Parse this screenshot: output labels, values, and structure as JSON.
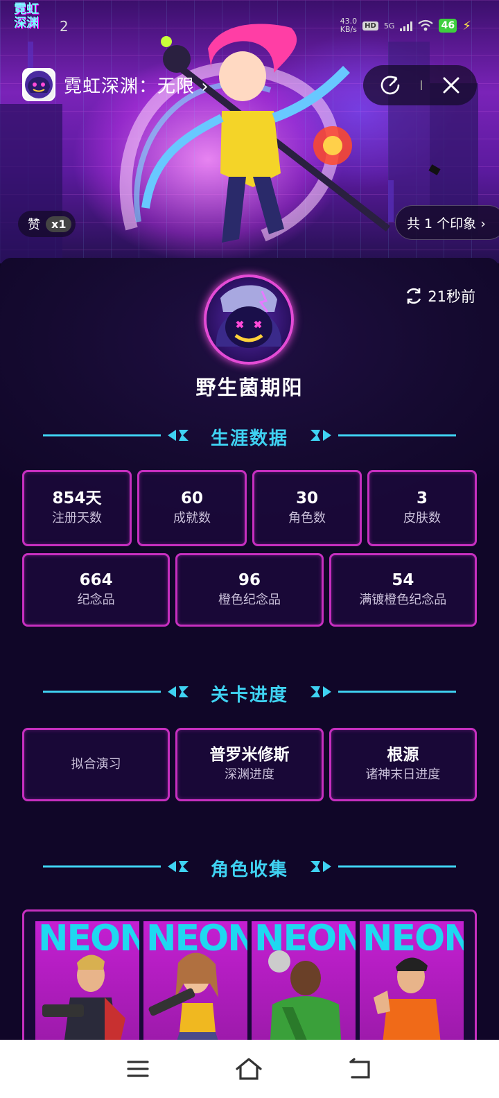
{
  "game_logo": {
    "line1": "霓虹",
    "line2": "深渊"
  },
  "status_bar": {
    "notification_count": "2",
    "net_speed_value": "43.0",
    "net_speed_unit": "KB/s",
    "hd": "HD",
    "network": "5G",
    "battery": "46"
  },
  "header": {
    "app_title": "霓虹深渊：无限 ›"
  },
  "hero": {
    "likes_label": "赞",
    "likes_count": "x1",
    "impressions_label": "共 1 个印象 ›"
  },
  "profile": {
    "refresh_time": "21秒前",
    "username": "野生菌期阳"
  },
  "career": {
    "title": "生涯数据",
    "row1": [
      {
        "value": "854天",
        "label": "注册天数"
      },
      {
        "value": "60",
        "label": "成就数"
      },
      {
        "value": "30",
        "label": "角色数"
      },
      {
        "value": "3",
        "label": "皮肤数"
      }
    ],
    "row2": [
      {
        "value": "664",
        "label": "纪念品"
      },
      {
        "value": "96",
        "label": "橙色纪念品"
      },
      {
        "value": "54",
        "label": "满镀橙色纪念品"
      }
    ]
  },
  "level_progress": {
    "title": "关卡进度",
    "items": [
      {
        "value": "",
        "label": "拟合演习"
      },
      {
        "value": "普罗米修斯",
        "label": "深渊进度"
      },
      {
        "value": "根源",
        "label": "诸神末日进度"
      }
    ]
  },
  "roles": {
    "title": "角色收集",
    "card_text": "NEON"
  },
  "colors": {
    "accent_cyan": "#3fd2f2",
    "card_border": "#c62fbf",
    "panel_bg": "#150a30"
  },
  "icons": [
    "menu-icon",
    "home-icon",
    "back-icon",
    "share-icon",
    "close-icon",
    "refresh-icon"
  ]
}
